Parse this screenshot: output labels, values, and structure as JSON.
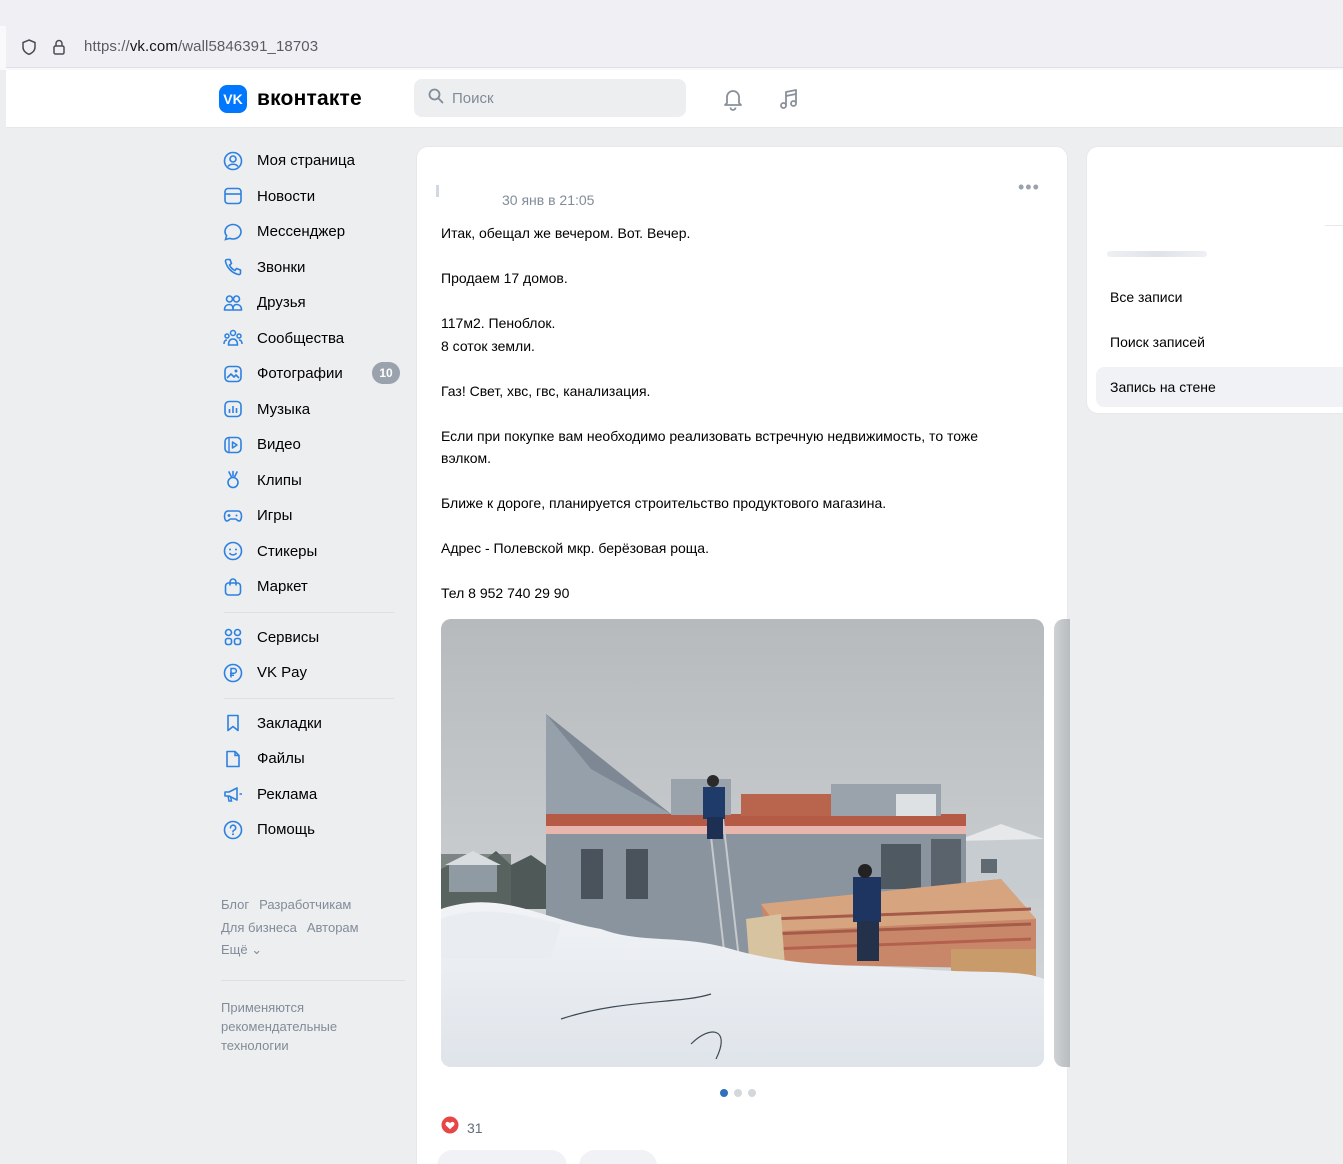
{
  "browser": {
    "url_prefix": "https://",
    "url_domain": "vk.com",
    "url_path": "/wall5846391_18703"
  },
  "header": {
    "logo_badge": "VK",
    "logo_text": "вконтакте",
    "search_placeholder": "Поиск"
  },
  "sidebar": {
    "items": [
      {
        "label": "Моя страница",
        "icon": "profile-icon"
      },
      {
        "label": "Новости",
        "icon": "news-icon"
      },
      {
        "label": "Мессенджер",
        "icon": "messenger-icon"
      },
      {
        "label": "Звонки",
        "icon": "phone-icon"
      },
      {
        "label": "Друзья",
        "icon": "friends-icon"
      },
      {
        "label": "Сообщества",
        "icon": "communities-icon"
      },
      {
        "label": "Фотографии",
        "icon": "photos-icon",
        "badge": "10"
      },
      {
        "label": "Музыка",
        "icon": "music-icon"
      },
      {
        "label": "Видео",
        "icon": "video-icon"
      },
      {
        "label": "Клипы",
        "icon": "clips-icon"
      },
      {
        "label": "Игры",
        "icon": "games-icon"
      },
      {
        "label": "Стикеры",
        "icon": "stickers-icon"
      },
      {
        "label": "Маркет",
        "icon": "market-icon"
      }
    ],
    "items2": [
      {
        "label": "Сервисы",
        "icon": "services-icon"
      },
      {
        "label": "VK Pay",
        "icon": "vkpay-icon"
      }
    ],
    "items3": [
      {
        "label": "Закладки",
        "icon": "bookmark-icon"
      },
      {
        "label": "Файлы",
        "icon": "files-icon"
      },
      {
        "label": "Реклама",
        "icon": "ads-icon"
      },
      {
        "label": "Помощь",
        "icon": "help-icon"
      }
    ],
    "footer_links": [
      "Блог",
      "Разработчикам",
      "Для бизнеса",
      "Авторам",
      "Ещё ⌄"
    ],
    "footer_note": "Применяются рекомендательные технологии"
  },
  "post": {
    "date": "30 янв в 21:05",
    "more": "•••",
    "paragraphs": [
      "Итак, обещал же вечером. Вот. Вечер.",
      "Продаем 17 домов.",
      "117м2. Пеноблок.\n8 соток земли.",
      "Газ! Свет, хвс, гвс, канализация.",
      "Если при покупке вам необходимо реализовать встречную недвижимость, то тоже вэлком.",
      "Ближе к дороге, планируется строительство продуктового магазина.",
      "Адрес - Полевской мкр. берёзовая роща.",
      "Тел 8 952 740 29 90"
    ],
    "likes_count": "31"
  },
  "right_nav": {
    "items": [
      "Все записи",
      "Поиск записей",
      "Запись на стене"
    ],
    "active_index": 2
  },
  "colors": {
    "accent": "#0077ff",
    "like": "#e64646",
    "page_bg": "#edeef0"
  }
}
